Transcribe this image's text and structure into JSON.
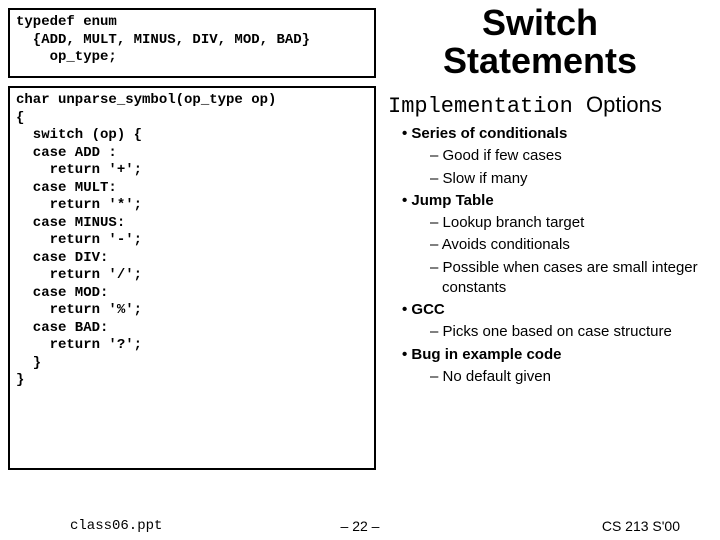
{
  "title_line1": "Switch",
  "title_line2": "Statements",
  "subtitle_word1": "Implementation",
  "subtitle_word2": "Options",
  "code_box1": "typedef enum\n  {ADD, MULT, MINUS, DIV, MOD, BAD}\n    op_type;",
  "code_box2": "char unparse_symbol(op_type op)\n{\n  switch (op) {\n  case ADD :\n    return '+';\n  case MULT:\n    return '*';\n  case MINUS:\n    return '-';\n  case DIV:\n    return '/';\n  case MOD:\n    return '%';\n  case BAD:\n    return '?';\n  }\n}",
  "bullets": {
    "b1": "Series of conditionals",
    "b1a": "Good if few cases",
    "b1b": "Slow if many",
    "b2": "Jump Table",
    "b2a": "Lookup branch target",
    "b2b": "Avoids conditionals",
    "b2c": "Possible when cases are small integer constants",
    "b3": "GCC",
    "b3a": "Picks one based on case structure",
    "b4": "Bug in example code",
    "b4a": "No default given"
  },
  "footer": {
    "left": "class06.ppt",
    "center": "– 22 –",
    "right": "CS 213 S'00"
  }
}
